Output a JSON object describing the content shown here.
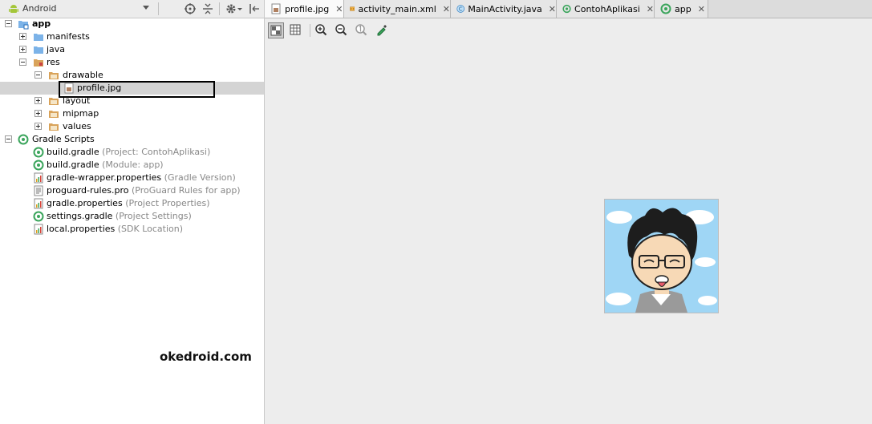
{
  "project_panel": {
    "view_mode": "Android",
    "tree": [
      {
        "label": "app",
        "hint": ""
      },
      {
        "label": "manifests",
        "hint": ""
      },
      {
        "label": "java",
        "hint": ""
      },
      {
        "label": "res",
        "hint": ""
      },
      {
        "label": "drawable",
        "hint": ""
      },
      {
        "label": "profile.jpg",
        "hint": ""
      },
      {
        "label": "layout",
        "hint": ""
      },
      {
        "label": "mipmap",
        "hint": ""
      },
      {
        "label": "values",
        "hint": ""
      },
      {
        "label": "Gradle Scripts",
        "hint": ""
      },
      {
        "label": "build.gradle",
        "hint": "(Project: ContohAplikasi)"
      },
      {
        "label": "build.gradle",
        "hint": "(Module: app)"
      },
      {
        "label": "gradle-wrapper.properties",
        "hint": "(Gradle Version)"
      },
      {
        "label": "proguard-rules.pro",
        "hint": "(ProGuard Rules for app)"
      },
      {
        "label": "gradle.properties",
        "hint": "(Project Properties)"
      },
      {
        "label": "settings.gradle",
        "hint": "(Project Settings)"
      },
      {
        "label": "local.properties",
        "hint": "(SDK Location)"
      }
    ]
  },
  "watermark": "okedroid.com",
  "editor": {
    "tabs": [
      {
        "label": "profile.jpg",
        "icon": "image-file-icon",
        "active": true
      },
      {
        "label": "activity_main.xml",
        "icon": "xml-file-icon",
        "active": false
      },
      {
        "label": "MainActivity.java",
        "icon": "java-class-icon",
        "active": false
      },
      {
        "label": "ContohAplikasi",
        "icon": "gradle-icon",
        "active": false
      },
      {
        "label": "app",
        "icon": "gradle-icon",
        "active": false
      }
    ],
    "close_glyph": "✕",
    "toolbar": [
      "chessboard-toggle-icon",
      "grid-toggle-icon",
      "zoom-in-icon",
      "zoom-out-icon",
      "actual-size-icon",
      "color-picker-icon"
    ]
  },
  "colors": {
    "folder": "#7cb3e8",
    "res_folder": "#d9a35a",
    "gradle": "#3ba55c",
    "android": "#a4c639"
  }
}
